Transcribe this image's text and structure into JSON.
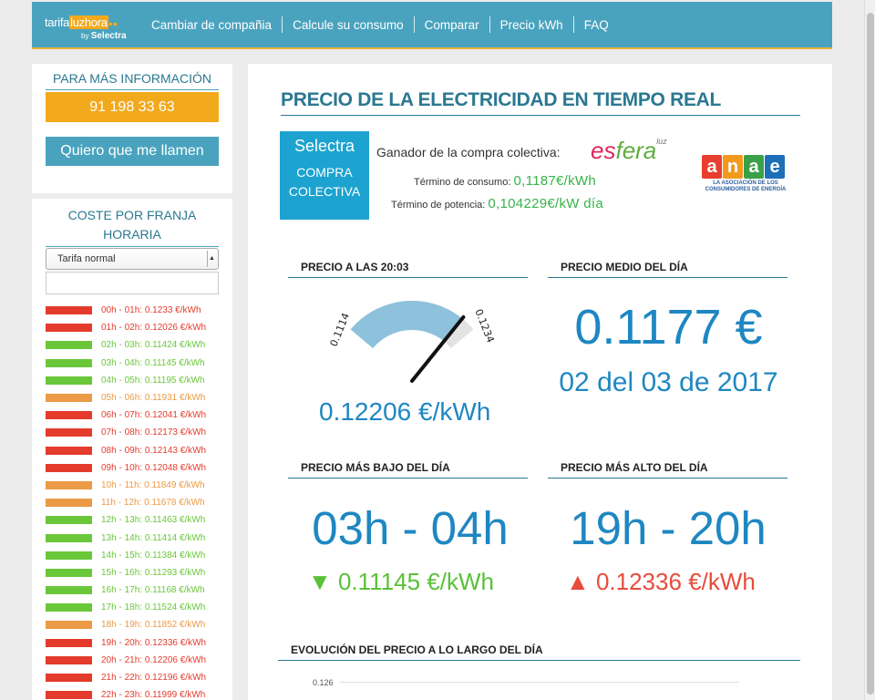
{
  "header": {
    "logo_main": "tarifa",
    "logo_highlight": "luzhora",
    "logo_by": "by",
    "logo_brand": "Selectra",
    "nav": [
      "Cambiar de compañia",
      "Calcule su consumo",
      "Comparar",
      "Precio kWh",
      "FAQ"
    ]
  },
  "sidebar": {
    "info_title": "PARA MÁS INFORMACIÓN",
    "phone": "91 198 33 63",
    "call_button": "Quiero que me llamen",
    "coste_title": "COSTE POR FRANJA HORARIA",
    "tarifa_selected": "Tarifa normal",
    "hours": [
      {
        "label": "00h - 01h: 0.1233 €/kWh",
        "color": "#e53b2c"
      },
      {
        "label": "01h - 02h: 0.12026 €/kWh",
        "color": "#e53b2c"
      },
      {
        "label": "02h - 03h: 0.11424 €/kWh",
        "color": "#6ac73a"
      },
      {
        "label": "03h - 04h: 0.11145 €/kWh",
        "color": "#6ac73a"
      },
      {
        "label": "04h - 05h: 0.11195 €/kWh",
        "color": "#6ac73a"
      },
      {
        "label": "05h - 06h: 0.11931 €/kWh",
        "color": "#eb9a45"
      },
      {
        "label": "06h - 07h: 0.12041 €/kWh",
        "color": "#e53b2c"
      },
      {
        "label": "07h - 08h: 0.12173 €/kWh",
        "color": "#e53b2c"
      },
      {
        "label": "08h - 09h: 0.12143 €/kWh",
        "color": "#e53b2c"
      },
      {
        "label": "09h - 10h: 0.12048 €/kWh",
        "color": "#e53b2c"
      },
      {
        "label": "10h - 11h: 0.11849 €/kWh",
        "color": "#eb9a45"
      },
      {
        "label": "11h - 12h: 0.11678 €/kWh",
        "color": "#eb9a45"
      },
      {
        "label": "12h - 13h: 0.11463 €/kWh",
        "color": "#6ac73a"
      },
      {
        "label": "13h - 14h: 0.11414 €/kWh",
        "color": "#6ac73a"
      },
      {
        "label": "14h - 15h: 0.11384 €/kWh",
        "color": "#6ac73a"
      },
      {
        "label": "15h - 16h: 0.11293 €/kWh",
        "color": "#6ac73a"
      },
      {
        "label": "16h - 17h: 0.11168 €/kWh",
        "color": "#6ac73a"
      },
      {
        "label": "17h - 18h: 0.11524 €/kWh",
        "color": "#6ac73a"
      },
      {
        "label": "18h - 19h: 0.11852 €/kWh",
        "color": "#eb9a45"
      },
      {
        "label": "19h - 20h: 0.12336 €/kWh",
        "color": "#e53b2c"
      },
      {
        "label": "20h - 21h: 0.12206 €/kWh",
        "color": "#e53b2c"
      },
      {
        "label": "21h - 22h: 0.12196 €/kWh",
        "color": "#e53b2c"
      },
      {
        "label": "22h - 23h: 0.11999 €/kWh",
        "color": "#e53b2c"
      }
    ]
  },
  "main": {
    "title": "PRECIO DE LA ELECTRICIDAD EN TIEMPO REAL",
    "selectra_brand": "Selectra",
    "compra": "COMPRA",
    "colectiva": "COLECTIVA",
    "ganador_label": "Ganador de la compra colectiva:",
    "esfera_a": "es",
    "esfera_b": "fera",
    "esfera_sup": "luz",
    "consumo_label": "Término de consumo:",
    "consumo_value": "0,1187€/kWh",
    "potencia_label": "Término de potencia:",
    "potencia_value": "0,104229€/kW día",
    "anae_letters": [
      "a",
      "n",
      "a",
      "e"
    ],
    "anae_sub": "LA ASOCIACIÓN DE LOS CONSUMIDORES DE ENERGÍA",
    "precio_actual_title": "PRECIO A LAS 20:03",
    "gauge_min": "0.1114",
    "gauge_max": "0.1234",
    "precio_actual": "0.12206 €/kWh",
    "precio_medio_title": "PRECIO MEDIO DEL DÍA",
    "precio_medio": "0.1177 €",
    "fecha": "02 del 03 de 2017",
    "bajo_title": "PRECIO MÁS BAJO DEL DÍA",
    "bajo_hora": "03h - 04h",
    "bajo_precio": "▼ 0.11145 €/kWh",
    "alto_title": "PRECIO MÁS ALTO DEL DÍA",
    "alto_hora": "19h - 20h",
    "alto_precio": "▲ 0.12336 €/kWh",
    "evolucion_title": "EVOLUCIÓN DEL PRECIO A LO LARGO DEL DÍA",
    "chart_y_label": "0.126"
  },
  "gauge": {
    "min": 0.1114,
    "max": 0.1234,
    "value": 0.12206,
    "fill_color": "#8dc1dc",
    "track_color": "#e3e3e3"
  }
}
